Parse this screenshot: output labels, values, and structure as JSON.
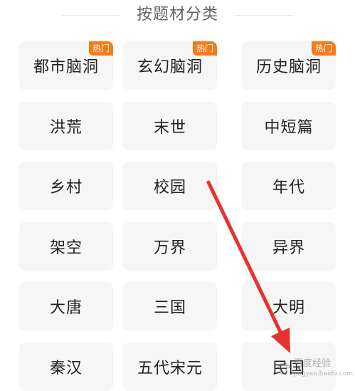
{
  "section": {
    "title": "按题材分类"
  },
  "badge": {
    "hot_label": "热门",
    "color": "#f77b19"
  },
  "tiles": [
    {
      "label": "都市脑洞",
      "hot": true
    },
    {
      "label": "玄幻脑洞",
      "hot": true
    },
    {
      "label": "历史脑洞",
      "hot": true
    },
    {
      "label": "洪荒",
      "hot": false
    },
    {
      "label": "末世",
      "hot": false
    },
    {
      "label": "中短篇",
      "hot": false
    },
    {
      "label": "乡村",
      "hot": false
    },
    {
      "label": "校园",
      "hot": false
    },
    {
      "label": "年代",
      "hot": false
    },
    {
      "label": "架空",
      "hot": false
    },
    {
      "label": "万界",
      "hot": false
    },
    {
      "label": "异界",
      "hot": false
    },
    {
      "label": "大唐",
      "hot": false
    },
    {
      "label": "三国",
      "hot": false
    },
    {
      "label": "大明",
      "hot": false
    },
    {
      "label": "秦汉",
      "hot": false
    },
    {
      "label": "五代宋元",
      "hot": false
    },
    {
      "label": "民国",
      "hot": false
    }
  ],
  "annotation": {
    "arrow_color": "#e8322f",
    "watermark_text": "百度经验",
    "watermark_sub": "jingyan.baidu.com"
  }
}
